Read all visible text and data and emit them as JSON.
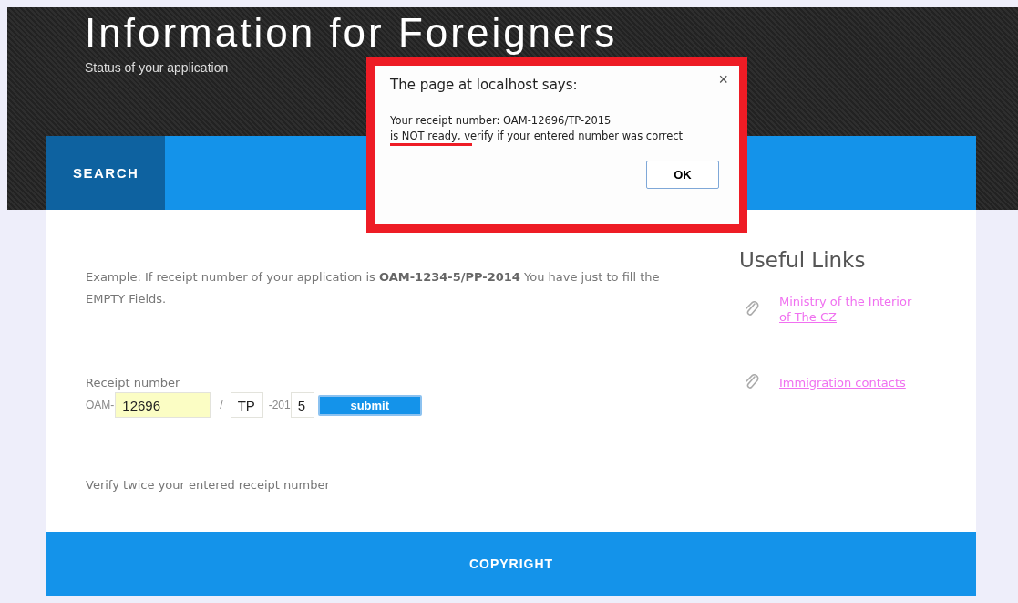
{
  "header": {
    "title": "Information for Foreigners",
    "subtitle": "Status of your application"
  },
  "nav": [
    {
      "label": "SEARCH",
      "selected": true
    }
  ],
  "intro": "Example: If receipt number of your application is **OAM-1234-5/PP-2014** You have just to fill the EMPTY Fields.",
  "form": {
    "label": "Receipt number",
    "prefix": "OAM-",
    "number": "12696",
    "separator": "/",
    "type": "TP",
    "year_prefix": "-201",
    "year_digit": "5",
    "submit": "submit"
  },
  "note": "Verify twice your entered receipt number",
  "useful_links": {
    "title": "Useful Links",
    "links": [
      "Ministry of the Interior of The CZ",
      "Immigration contacts"
    ]
  },
  "footer": "COPYRIGHT",
  "dialog": {
    "title": "The page at localhost says:",
    "lines": [
      "Your receipt number: OAM-12696/TP-2015",
      "is NOT ready, verify if your entered number was correct"
    ],
    "ok": "OK",
    "close": "×"
  }
}
